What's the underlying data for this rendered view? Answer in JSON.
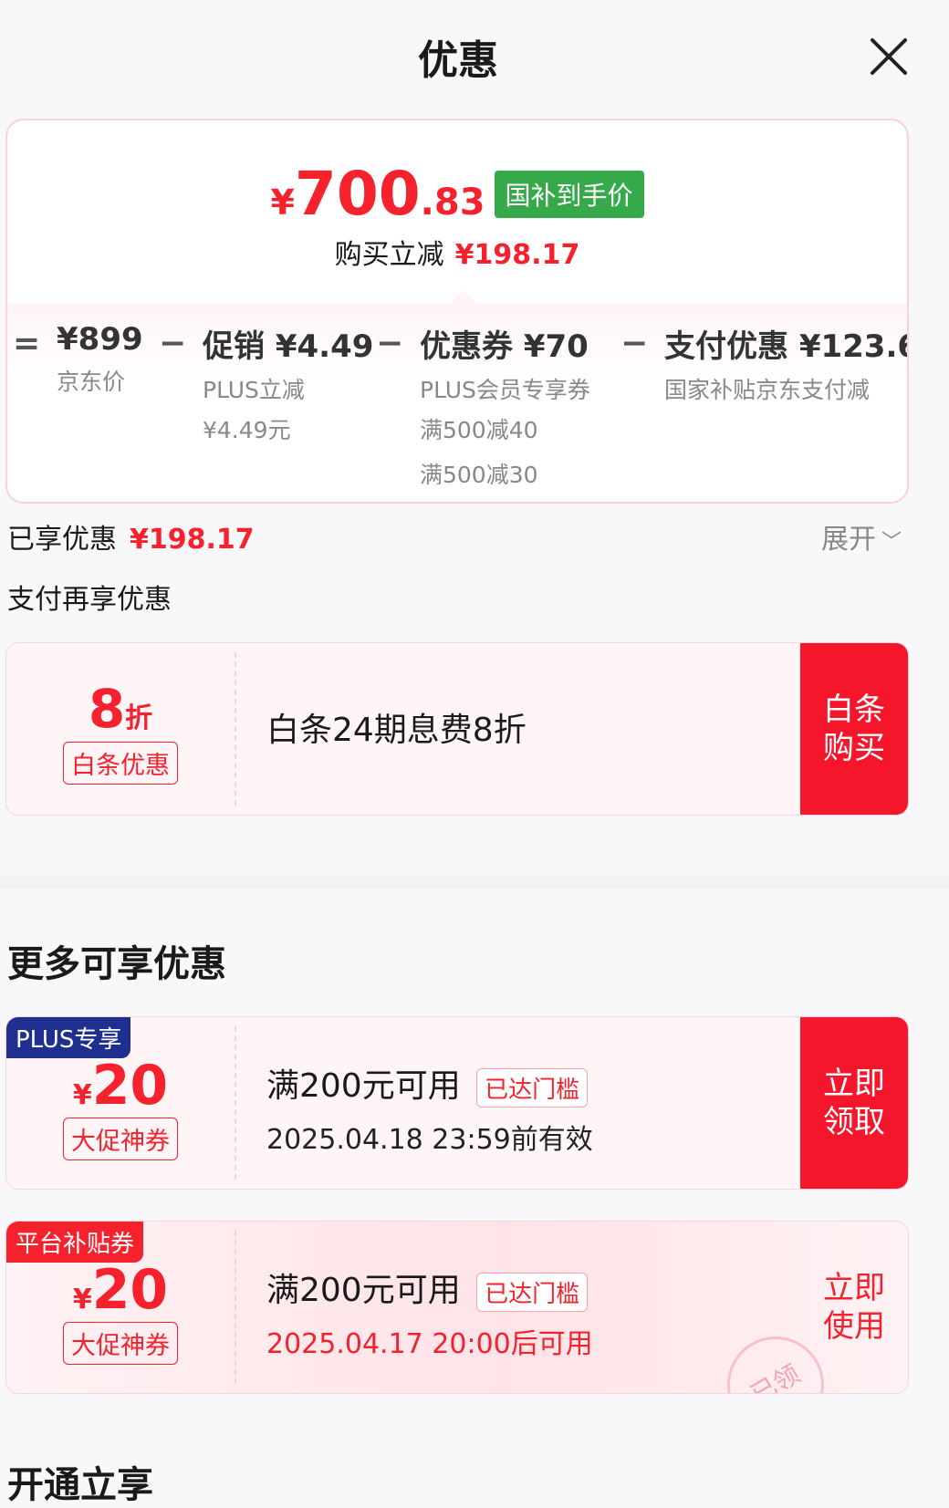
{
  "header": {
    "title": "优惠",
    "close_icon": "close-icon"
  },
  "price_card": {
    "final_symbol": "¥",
    "final_int": "700",
    "final_dec": ".83",
    "final_badge": "国补到手价",
    "reduce_label": "购买立减",
    "reduce_amount": "¥198.17",
    "breakdown": [
      {
        "op": "=",
        "main": "¥899",
        "sub": "京东价",
        "sub2": ""
      },
      {
        "op": "−",
        "main": "促销 ¥4.49",
        "sub": "PLUS立减",
        "sub2": "¥4.49元"
      },
      {
        "op": "−",
        "main": "优惠券 ¥70",
        "sub": "PLUS会员专享券",
        "sub2": "满500减40",
        "sub3": "满500减30"
      },
      {
        "op": "−",
        "main": "支付优惠 ¥123.6",
        "sub": "国家补贴京东支付减",
        "sub2": ""
      }
    ]
  },
  "enjoyed": {
    "label": "已享优惠",
    "amount": "¥198.17",
    "expand": "展开"
  },
  "pay_more": "支付再享优惠",
  "baitiao": {
    "discount_num": "8",
    "discount_unit": "折",
    "tag": "白条优惠",
    "desc": "白条24期息费8折",
    "action_line1": "白条",
    "action_line2": "购买"
  },
  "more_title": "更多可享优惠",
  "coupons": [
    {
      "corner": "PLUS专享",
      "corner_color": "#1f2f8f",
      "symbol": "¥",
      "amount": "20",
      "tag": "大促神券",
      "condition": "满200元可用",
      "status": "已达门槛",
      "validity": "2025.04.18 23:59前有效",
      "action_line1": "立即",
      "action_line2": "领取"
    },
    {
      "corner": "平台补贴券",
      "corner_color": "#f5222d",
      "symbol": "¥",
      "amount": "20",
      "tag": "大促神券",
      "condition": "满200元可用",
      "status": "已达门槛",
      "validity": "2025.04.17 20:00后可用",
      "action_line1": "立即",
      "action_line2": "使用",
      "stamp": "已领"
    }
  ],
  "next_title": "开通立享"
}
